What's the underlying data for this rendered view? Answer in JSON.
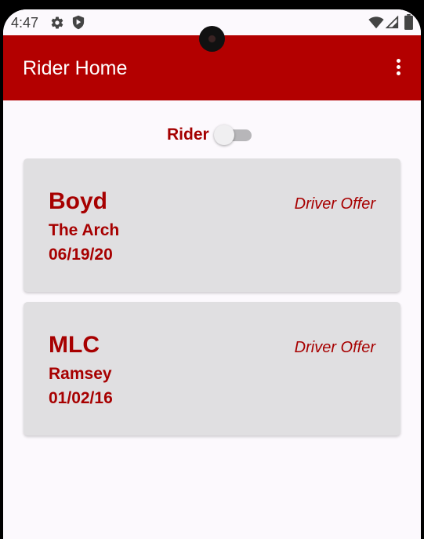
{
  "status_bar": {
    "time": "4:47",
    "icons": [
      "gear-icon",
      "shield-icon",
      "wifi-icon",
      "signal-icon",
      "battery-icon"
    ]
  },
  "app_bar": {
    "title": "Rider Home",
    "menu_icon": "more-vertical-icon",
    "color": "#b30000"
  },
  "mode_toggle": {
    "label": "Rider",
    "checked": false
  },
  "rides": [
    {
      "name": "Boyd",
      "location": "The Arch",
      "date": "06/19/20",
      "type": "Driver Offer"
    },
    {
      "name": "MLC",
      "location": "Ramsey",
      "date": "01/02/16",
      "type": "Driver Offer"
    }
  ],
  "colors": {
    "accent": "#a70000",
    "card_background": "#e0dfe1",
    "page_background": "#fcf9fd"
  }
}
